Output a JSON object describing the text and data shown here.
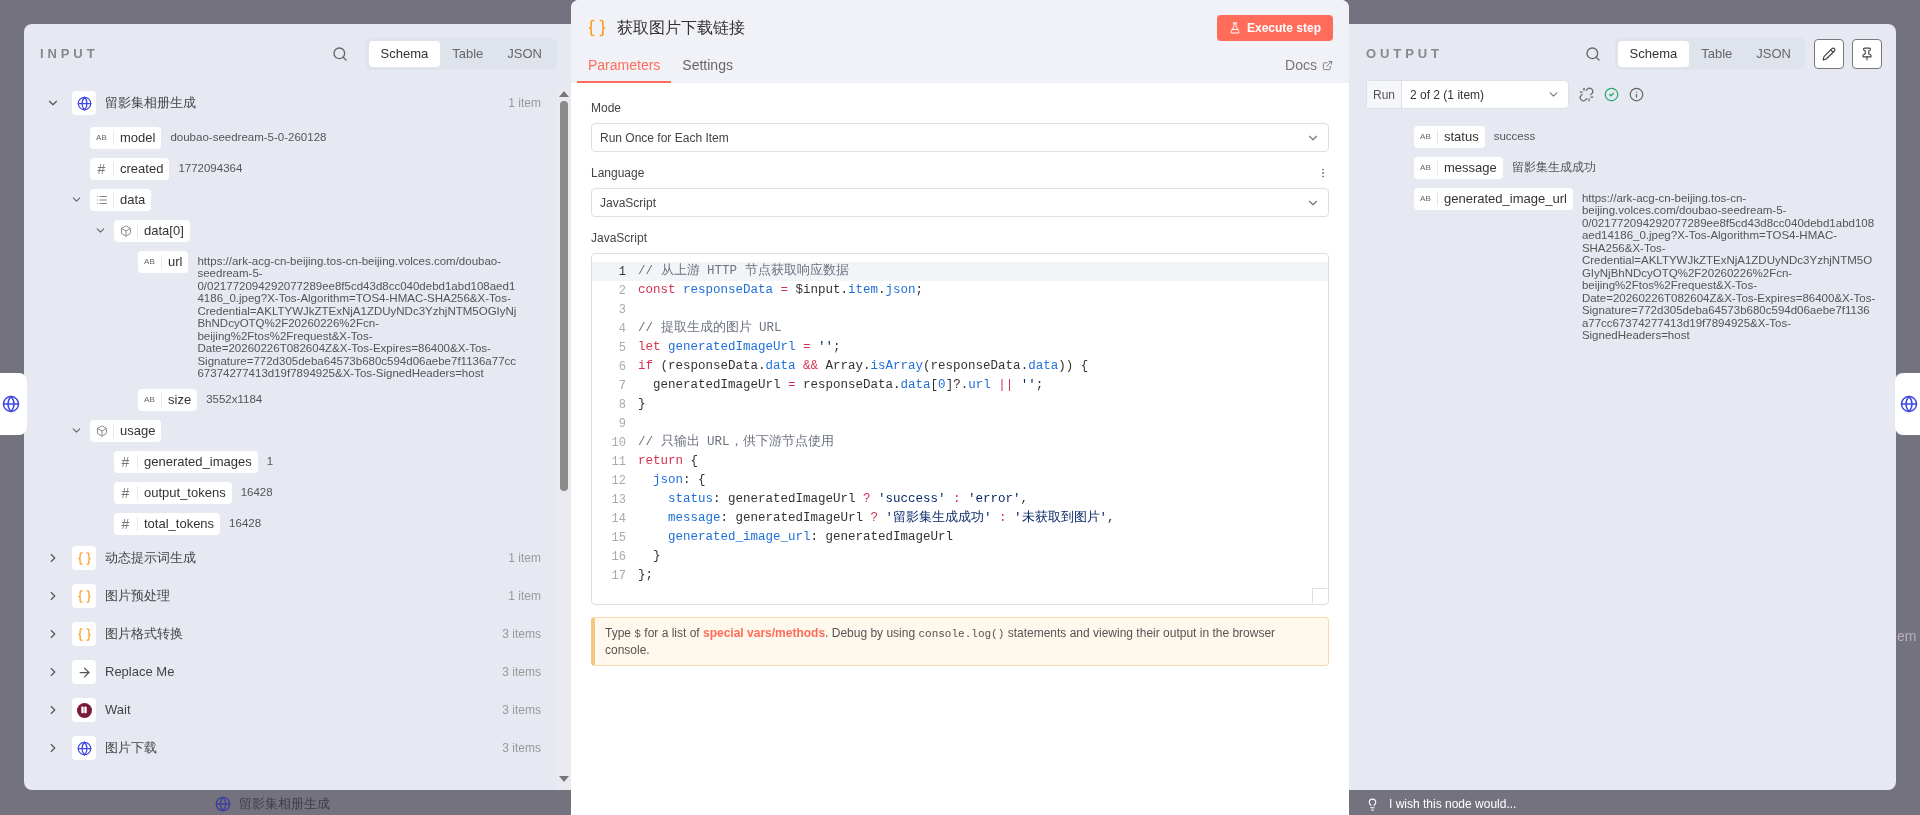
{
  "input": {
    "title": "INPUT",
    "view_tabs": [
      {
        "label": "Schema",
        "selected": true
      },
      {
        "label": "Table",
        "selected": false
      },
      {
        "label": "JSON",
        "selected": false
      }
    ],
    "nodes": [
      {
        "kind": "http",
        "name": "留影集相册生成",
        "count": "1 item",
        "expanded": true,
        "fields": [
          {
            "kind": "string",
            "badge": "AB",
            "key": "model",
            "value": "doubao-seedream-5-0-260128"
          },
          {
            "kind": "number",
            "badge": "#",
            "key": "created",
            "value": "1772094364"
          },
          {
            "kind": "array",
            "key": "data",
            "expanded": true,
            "children": [
              {
                "kind": "object",
                "key": "data[0]",
                "expanded": true,
                "children": [
                  {
                    "kind": "string",
                    "badge": "AB",
                    "key": "url",
                    "value": "https://ark-acg-cn-beijing.tos-cn-beijing.volces.com/doubao-seedream-5-0/021772094292077289ee8f5cd43d8cc040debd1abd108aed14186_0.jpeg?X-Tos-Algorithm=TOS4-HMAC-SHA256&X-Tos-Credential=AKLTYWJkZTExNjA1ZDUyNDc3YzhjNTM5OGIyNjBhNDcyOTQ%2F20260226%2Fcn-beijing%2Ftos%2Frequest&X-Tos-Date=20260226T082604Z&X-Tos-Expires=86400&X-Tos-Signature=772d305deba64573b680c594d06aebe7f1136a77cc67374277413d19f7894925&X-Tos-SignedHeaders=host"
                  },
                  {
                    "kind": "string",
                    "badge": "AB",
                    "key": "size",
                    "value": "3552x1184"
                  }
                ]
              }
            ]
          },
          {
            "kind": "object",
            "key": "usage",
            "expanded": true,
            "children": [
              {
                "kind": "number",
                "badge": "#",
                "key": "generated_images",
                "value": "1"
              },
              {
                "kind": "number",
                "badge": "#",
                "key": "output_tokens",
                "value": "16428"
              },
              {
                "kind": "number",
                "badge": "#",
                "key": "total_tokens",
                "value": "16428"
              }
            ]
          }
        ]
      },
      {
        "kind": "code",
        "name": "动态提示词生成",
        "count": "1 item",
        "expanded": false
      },
      {
        "kind": "code",
        "name": "图片预处理",
        "count": "1 item",
        "expanded": false
      },
      {
        "kind": "code",
        "name": "图片格式转换",
        "count": "3 items",
        "expanded": false
      },
      {
        "kind": "noop",
        "name": "Replace Me",
        "count": "3 items",
        "expanded": false
      },
      {
        "kind": "wait",
        "name": "Wait",
        "count": "3 items",
        "expanded": false
      },
      {
        "kind": "http",
        "name": "图片下载",
        "count": "3 items",
        "expanded": false
      }
    ]
  },
  "node": {
    "title": "获取图片下载链接",
    "execute_label": "Execute step",
    "tabs": [
      {
        "label": "Parameters",
        "selected": true
      },
      {
        "label": "Settings",
        "selected": false
      }
    ],
    "docs_label": "Docs",
    "mode": {
      "label": "Mode",
      "value": "Run Once for Each Item"
    },
    "language": {
      "label": "Language",
      "value": "JavaScript"
    },
    "code": {
      "label": "JavaScript",
      "lines": [
        {
          "number": "1",
          "active": true,
          "segments": [
            {
              "kind": "comment",
              "text": "// 从上游 HTTP 节点获取响应数据"
            }
          ]
        },
        {
          "number": "2",
          "active": false,
          "segments": [
            {
              "kind": "keyword",
              "text": "const "
            },
            {
              "kind": "variable",
              "text": "responseData"
            },
            {
              "kind": "operator",
              "text": " = "
            },
            {
              "kind": "plain",
              "text": "$input."
            },
            {
              "kind": "variable",
              "text": "item"
            },
            {
              "kind": "plain",
              "text": "."
            },
            {
              "kind": "variable",
              "text": "json"
            },
            {
              "kind": "plain",
              "text": ";"
            }
          ]
        },
        {
          "number": "3",
          "active": false
        },
        {
          "number": "4",
          "active": false,
          "segments": [
            {
              "kind": "comment",
              "text": "// 提取生成的图片 URL"
            }
          ]
        },
        {
          "number": "5",
          "active": false,
          "segments": [
            {
              "kind": "keyword",
              "text": "let "
            },
            {
              "kind": "variable",
              "text": "generatedImageUrl"
            },
            {
              "kind": "operator",
              "text": " = "
            },
            {
              "kind": "string",
              "text": "''"
            },
            {
              "kind": "plain",
              "text": ";"
            }
          ]
        },
        {
          "number": "6",
          "active": false,
          "segments": [
            {
              "kind": "keyword",
              "text": "if"
            },
            {
              "kind": "plain",
              "text": " (responseData."
            },
            {
              "kind": "variable",
              "text": "data"
            },
            {
              "kind": "operator",
              "text": " && "
            },
            {
              "kind": "plain",
              "text": "Array."
            },
            {
              "kind": "variable",
              "text": "isArray"
            },
            {
              "kind": "plain",
              "text": "(responseData."
            },
            {
              "kind": "variable",
              "text": "data"
            },
            {
              "kind": "plain",
              "text": ")) {"
            }
          ]
        },
        {
          "number": "7",
          "active": false,
          "segments": [
            {
              "kind": "plain",
              "text": "  generatedImageUrl "
            },
            {
              "kind": "operator",
              "text": "="
            },
            {
              "kind": "plain",
              "text": " responseData."
            },
            {
              "kind": "variable",
              "text": "data"
            },
            {
              "kind": "plain",
              "text": "["
            },
            {
              "kind": "variable",
              "text": "0"
            },
            {
              "kind": "plain",
              "text": "]?."
            },
            {
              "kind": "variable",
              "text": "url"
            },
            {
              "kind": "operator",
              "text": " || "
            },
            {
              "kind": "string",
              "text": "''"
            },
            {
              "kind": "plain",
              "text": ";"
            }
          ]
        },
        {
          "number": "8",
          "active": false,
          "segments": [
            {
              "kind": "plain",
              "text": "}"
            }
          ]
        },
        {
          "number": "9",
          "active": false
        },
        {
          "number": "10",
          "active": false,
          "segments": [
            {
              "kind": "comment",
              "text": "// 只输出 URL，供下游节点使用"
            }
          ]
        },
        {
          "number": "11",
          "active": false,
          "segments": [
            {
              "kind": "keyword",
              "text": "return"
            },
            {
              "kind": "plain",
              "text": " {"
            }
          ]
        },
        {
          "number": "12",
          "active": false,
          "segments": [
            {
              "kind": "variable",
              "text": "  json"
            },
            {
              "kind": "plain",
              "text": ": {"
            }
          ]
        },
        {
          "number": "13",
          "active": false,
          "segments": [
            {
              "kind": "variable",
              "text": "    status"
            },
            {
              "kind": "plain",
              "text": ": generatedImageUrl "
            },
            {
              "kind": "operator",
              "text": "? "
            },
            {
              "kind": "string",
              "text": "'success'"
            },
            {
              "kind": "operator",
              "text": " : "
            },
            {
              "kind": "string",
              "text": "'error'"
            },
            {
              "kind": "plain",
              "text": ","
            }
          ]
        },
        {
          "number": "14",
          "active": false,
          "segments": [
            {
              "kind": "variable",
              "text": "    message"
            },
            {
              "kind": "plain",
              "text": ": generatedImageUrl "
            },
            {
              "kind": "operator",
              "text": "? "
            },
            {
              "kind": "string",
              "text": "'留影集生成成功'"
            },
            {
              "kind": "operator",
              "text": " : "
            },
            {
              "kind": "string",
              "text": "'未获取到图片'"
            },
            {
              "kind": "plain",
              "text": ","
            }
          ]
        },
        {
          "number": "15",
          "active": false,
          "segments": [
            {
              "kind": "variable",
              "text": "    generated_image_url"
            },
            {
              "kind": "plain",
              "text": ": generatedImageUrl"
            }
          ]
        },
        {
          "number": "16",
          "active": false,
          "segments": [
            {
              "kind": "plain",
              "text": "  }"
            }
          ]
        },
        {
          "number": "17",
          "active": false,
          "segments": [
            {
              "kind": "plain",
              "text": "};"
            }
          ]
        }
      ]
    },
    "hint": [
      {
        "kind": "text",
        "text": "Type "
      },
      {
        "kind": "code",
        "text": "$"
      },
      {
        "kind": "text",
        "text": " for a list of "
      },
      {
        "kind": "link",
        "text": "special vars/methods"
      },
      {
        "kind": "text",
        "text": ". Debug by using "
      },
      {
        "kind": "code",
        "text": "console.log()"
      },
      {
        "kind": "text",
        "text": " statements and viewing their output in the browser console."
      }
    ]
  },
  "output": {
    "title": "OUTPUT",
    "view_tabs": [
      {
        "label": "Schema",
        "selected": true
      },
      {
        "label": "Table",
        "selected": false
      },
      {
        "label": "JSON",
        "selected": false
      }
    ],
    "run": {
      "label": "Run",
      "value": "2 of 2 (1 item)"
    },
    "fields": [
      {
        "kind": "string",
        "badge": "AB",
        "key": "status",
        "value": "success"
      },
      {
        "kind": "string",
        "badge": "AB",
        "key": "message",
        "value": "留影集生成成功"
      },
      {
        "kind": "string",
        "badge": "AB",
        "key": "generated_image_url",
        "value": "https://ark-acg-cn-beijing.tos-cn-beijing.volces.com/doubao-seedream-5-0/021772094292077289ee8f5cd43d8cc040debd1abd108aed14186_0.jpeg?X-Tos-Algorithm=TOS4-HMAC-SHA256&X-Tos-Credential=AKLTYWJkZTExNjA1ZDUyNDc3YzhjNTM5OGIyNjBhNDcyOTQ%2F20260226%2Fcn-beijing%2Ftos%2Frequest&X-Tos-Date=20260226T082604Z&X-Tos-Expires=86400&X-Tos-Signature=772d305deba64573b680c594d06aebe7f1136a77cc67374277413d19f7894925&X-Tos-SignedHeaders=host"
      }
    ]
  },
  "canvas": {
    "node_label": "留影集相册生成",
    "feedback": "I wish this node would...",
    "edge_text": "em"
  }
}
